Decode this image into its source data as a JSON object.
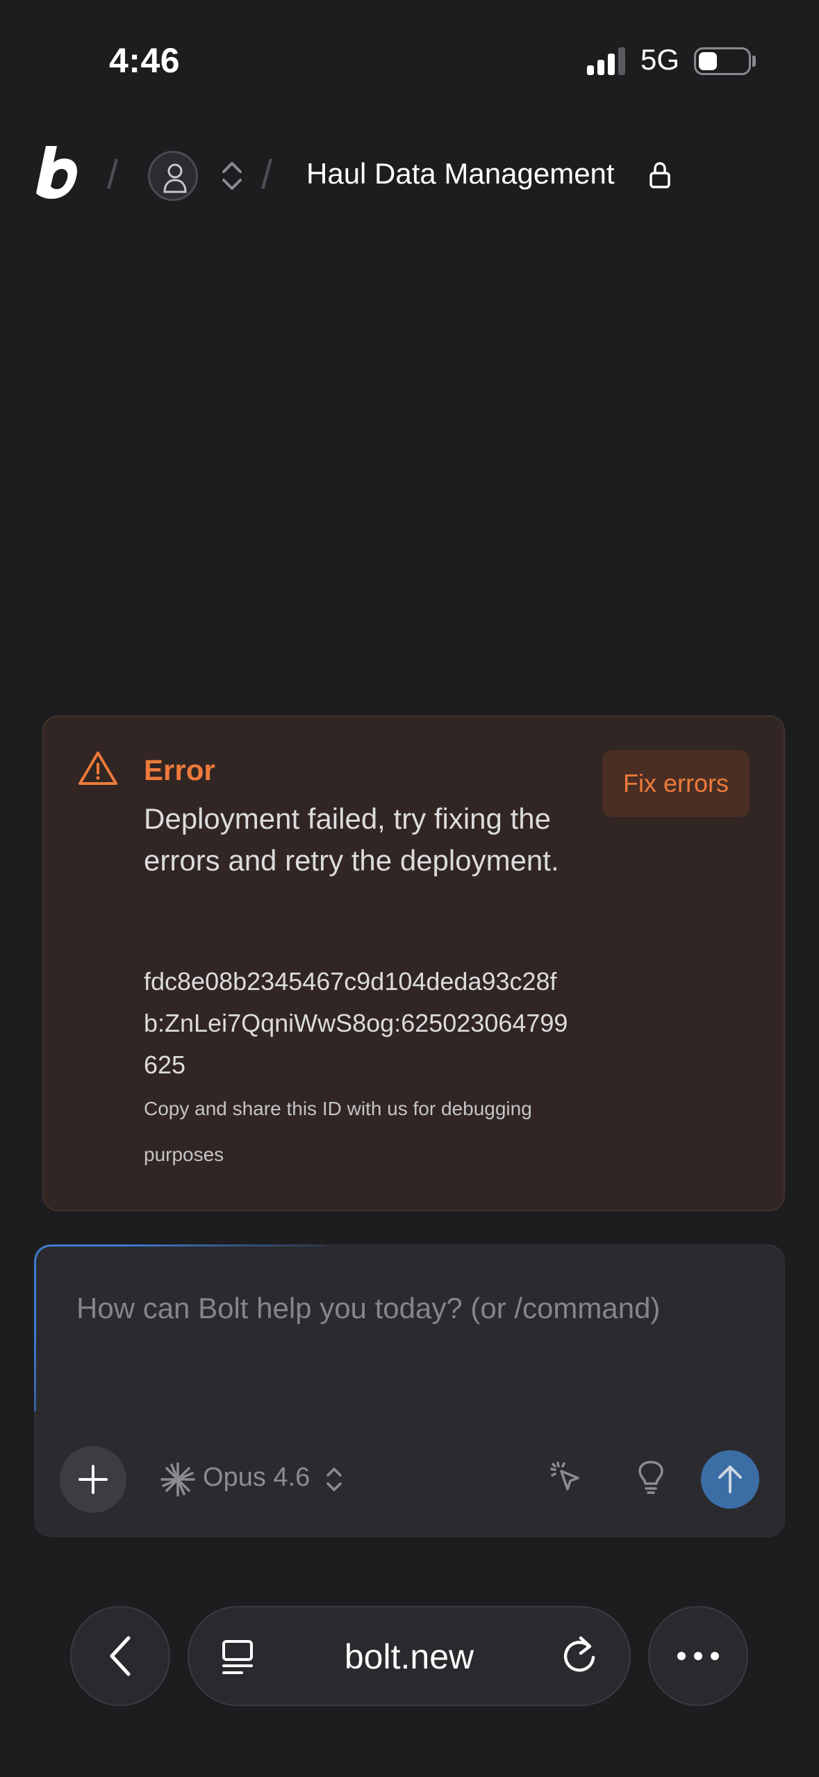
{
  "status_bar": {
    "time": "4:46",
    "network": "5G",
    "signal_icon": "signal-bars-icon",
    "battery_icon": "battery-icon"
  },
  "header": {
    "logo": "bolt-logo",
    "separator": "/",
    "project_title": "Haul Data Management",
    "lock_icon": "lock-icon"
  },
  "error": {
    "title": "Error",
    "message": "Deployment failed, try fixing the errors and retry the deployment.",
    "id": "fdc8e08b2345467c9d104deda93c28fb:ZnLei7QqniWwS8og:625023064799625",
    "note": "Copy and share this ID with us for debugging purposes",
    "fix_button": "Fix errors",
    "accent_color": "#ee7a3b"
  },
  "chat": {
    "placeholder": "How can Bolt help you today? (or /command)",
    "model": "Opus 4.6",
    "send_color": "#3c6ea6"
  },
  "browser": {
    "url": "bolt.new"
  }
}
